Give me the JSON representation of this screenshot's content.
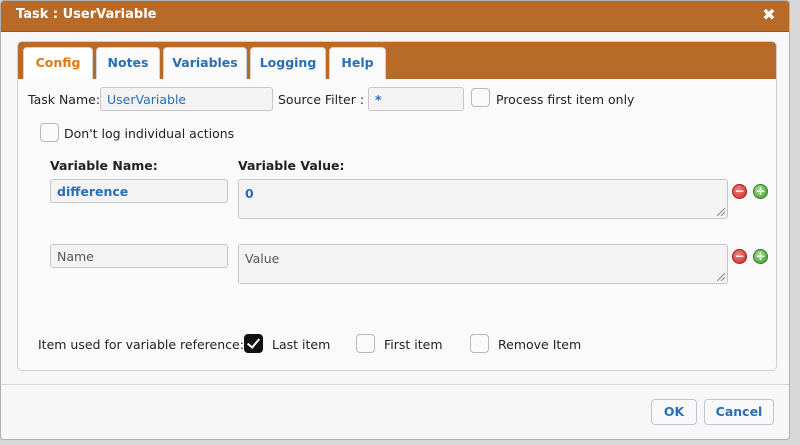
{
  "dialog": {
    "title": "Task : UserVariable",
    "close_glyph": "✖"
  },
  "tabs": [
    {
      "label": "Config",
      "active": true
    },
    {
      "label": "Notes",
      "active": false
    },
    {
      "label": "Variables",
      "active": false
    },
    {
      "label": "Logging",
      "active": false
    },
    {
      "label": "Help",
      "active": false
    }
  ],
  "config": {
    "task_name_label": "Task Name:",
    "task_name_value": "UserVariable",
    "source_filter_label": "Source Filter :",
    "source_filter_value": "*",
    "process_first_label": "Process first item only",
    "process_first_checked": false,
    "dont_log_label": "Don't log individual actions",
    "dont_log_checked": false
  },
  "variables": {
    "name_header": "Variable Name:",
    "value_header": "Variable Value:",
    "rows": [
      {
        "name": "difference",
        "value": "0"
      },
      {
        "name_placeholder": "Name",
        "value_placeholder": "Value"
      }
    ]
  },
  "reference": {
    "label": "Item used for variable reference:",
    "options": [
      {
        "label": "Last item",
        "checked": true
      },
      {
        "label": "First item",
        "checked": false
      },
      {
        "label": "Remove Item",
        "checked": false
      }
    ]
  },
  "buttons": {
    "ok": "OK",
    "cancel": "Cancel"
  },
  "icons": {
    "remove": "minus-circle-icon",
    "add": "plus-circle-icon"
  },
  "colors": {
    "titlebar": "#b86a28",
    "accent": "#2a6fb5",
    "active_tab": "#e07a10"
  }
}
